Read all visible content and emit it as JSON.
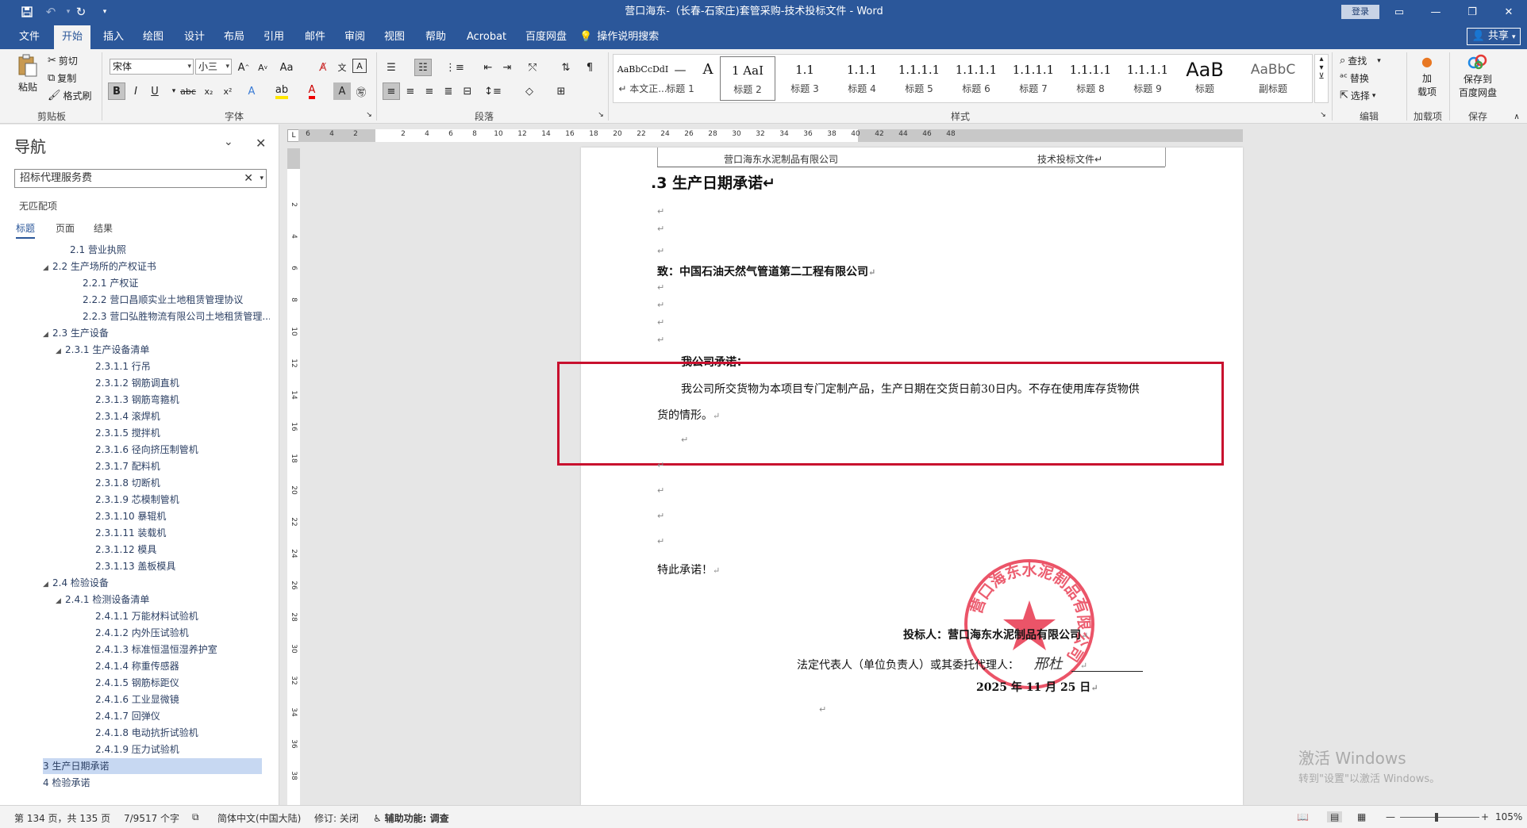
{
  "window": {
    "title": "营口海东-（长春-石家庄)套管采购-技术投标文件  -  Word",
    "login_label": "登录"
  },
  "quick_access": {
    "save_icon": "save-icon",
    "undo_icon": "undo-icon",
    "redo_icon": "redo-icon"
  },
  "menu": {
    "tabs": [
      "文件",
      "开始",
      "插入",
      "绘图",
      "设计",
      "布局",
      "引用",
      "邮件",
      "审阅",
      "视图",
      "帮助",
      "Acrobat",
      "百度网盘"
    ],
    "active_tab": "开始",
    "tell_me": "操作说明搜索",
    "share": "共享"
  },
  "ribbon": {
    "clipboard": {
      "paste": "粘贴",
      "cut": "剪切",
      "copy": "复制",
      "format_painter": "格式刷",
      "group": "剪贴板"
    },
    "font": {
      "font_name": "宋体",
      "font_size": "小三",
      "group": "字体"
    },
    "paragraph": {
      "group": "段落"
    },
    "styles": {
      "group": "样式",
      "items": [
        {
          "preview": "AaBbCcDdI",
          "name": "↵ 本文正..."
        },
        {
          "preview": "—",
          "name": "标题 1"
        },
        {
          "preview": "A",
          "name": ""
        },
        {
          "preview": "1  AaI",
          "name": "标题 2"
        },
        {
          "preview": "1.1",
          "name": "标题 3"
        },
        {
          "preview": "1.1.1",
          "name": "标题 4"
        },
        {
          "preview": "1.1.1.1",
          "name": "标题 5"
        },
        {
          "preview": "1.1.1.1",
          "name": "标题 6"
        },
        {
          "preview": "1.1.1.1",
          "name": "标题 7"
        },
        {
          "preview": "1.1.1.1",
          "name": "标题 8"
        },
        {
          "preview": "1.1.1.1",
          "name": "标题 9"
        },
        {
          "preview": "AaB",
          "name": "标题"
        },
        {
          "preview": "AaBbC",
          "name": "副标题"
        }
      ]
    },
    "editing": {
      "find": "查找",
      "replace": "替换",
      "select": "选择",
      "group": "编辑"
    },
    "addins": {
      "label": "加\n载项",
      "group": "加载项"
    },
    "save": {
      "label": "保存到\n百度网盘",
      "group": "保存"
    }
  },
  "nav": {
    "title": "导航",
    "search_value": "招标代理服务费",
    "no_match": "无匹配项",
    "tabs": [
      "标题",
      "页面",
      "结果"
    ],
    "items": [
      {
        "text": "2.1 营业执照",
        "level": 2,
        "toggle": ""
      },
      {
        "text": "2.2 生产场所的产权证书",
        "level": 1,
        "toggle": "◢"
      },
      {
        "text": "2.2.1 产权证",
        "level": 3,
        "toggle": ""
      },
      {
        "text": "2.2.2 营口昌顺实业土地租赁管理协议",
        "level": 3,
        "toggle": ""
      },
      {
        "text": "2.2.3 营口弘胜物流有限公司土地租赁管理...",
        "level": 3,
        "toggle": ""
      },
      {
        "text": "2.3 生产设备",
        "level": 1,
        "toggle": "◢"
      },
      {
        "text": "2.3.1 生产设备清单",
        "level": 2,
        "toggle": "◢"
      },
      {
        "text": "2.3.1.1 行吊",
        "level": 4,
        "toggle": ""
      },
      {
        "text": "2.3.1.2 钢筋调直机",
        "level": 4,
        "toggle": ""
      },
      {
        "text": "2.3.1.3 钢筋弯箍机",
        "level": 4,
        "toggle": ""
      },
      {
        "text": "2.3.1.4 滚焊机",
        "level": 4,
        "toggle": ""
      },
      {
        "text": "2.3.1.5 搅拌机",
        "level": 4,
        "toggle": ""
      },
      {
        "text": "2.3.1.6 径向挤压制管机",
        "level": 4,
        "toggle": ""
      },
      {
        "text": "2.3.1.7 配料机",
        "level": 4,
        "toggle": ""
      },
      {
        "text": "2.3.1.8 切断机",
        "level": 4,
        "toggle": ""
      },
      {
        "text": "2.3.1.9 芯模制管机",
        "level": 4,
        "toggle": ""
      },
      {
        "text": "2.3.1.10 暴辊机",
        "level": 4,
        "toggle": ""
      },
      {
        "text": "2.3.1.11 装载机",
        "level": 4,
        "toggle": ""
      },
      {
        "text": "2.3.1.12 模具",
        "level": 4,
        "toggle": ""
      },
      {
        "text": "2.3.1.13 盖板模具",
        "level": 4,
        "toggle": ""
      },
      {
        "text": "2.4 检验设备",
        "level": 1,
        "toggle": "◢"
      },
      {
        "text": "2.4.1 检测设备清单",
        "level": 2,
        "toggle": "◢"
      },
      {
        "text": "2.4.1.1 万能材料试验机",
        "level": 4,
        "toggle": ""
      },
      {
        "text": "2.4.1.2 内外压试验机",
        "level": 4,
        "toggle": ""
      },
      {
        "text": "2.4.1.3 标准恒温恒湿养护室",
        "level": 4,
        "toggle": ""
      },
      {
        "text": "2.4.1.4 称重传感器",
        "level": 4,
        "toggle": ""
      },
      {
        "text": "2.4.1.5 钢筋标距仪",
        "level": 4,
        "toggle": ""
      },
      {
        "text": "2.4.1.6 工业显微镜",
        "level": 4,
        "toggle": ""
      },
      {
        "text": "2.4.1.7 回弹仪",
        "level": 4,
        "toggle": ""
      },
      {
        "text": "2.4.1.8 电动抗折试验机",
        "level": 4,
        "toggle": ""
      },
      {
        "text": "2.4.1.9 压力试验机",
        "level": 4,
        "toggle": ""
      },
      {
        "text": "3 生产日期承诺",
        "level": 0,
        "toggle": "",
        "selected": true
      },
      {
        "text": "4 检验承诺",
        "level": 0,
        "toggle": ""
      }
    ]
  },
  "ruler": {
    "h_ticks": [
      "6",
      "4",
      "2",
      "",
      "2",
      "4",
      "6",
      "8",
      "10",
      "12",
      "14",
      "16",
      "18",
      "20",
      "22",
      "24",
      "26",
      "28",
      "30",
      "32",
      "34",
      "36",
      "38",
      "40",
      "42",
      "44",
      "46",
      "48"
    ],
    "v_ticks": [
      "2",
      "4",
      "6",
      "8",
      "10",
      "12",
      "14",
      "16",
      "18",
      "20",
      "22",
      "24",
      "26",
      "28",
      "30",
      "32",
      "34",
      "36",
      "38"
    ]
  },
  "document": {
    "header_left": "营口海东水泥制品有限公司",
    "header_right": "技术投标文件↵",
    "heading": ".3 生产日期承诺↵",
    "to_line": "致：中国石油天然气管道第二工程有限公司",
    "promise_title": "我公司承诺：",
    "promise_line1": "我公司所交货物为本项目专门定制产品，生产日期在交货日前30日内。不存在使用库存货物供",
    "promise_line2": "货的情形。",
    "closing": "特此承诺！",
    "bidder": "投标人：营口海东水泥制品有限公司",
    "legal_rep": "法定代表人（单位负责人）或其委托代理人：",
    "signature": "邢杜",
    "date": "2025 年 11 月 25 日",
    "pilcrow": "↵",
    "stamp_text": "营口海东水泥制品有限公司"
  },
  "status": {
    "page": "第 134 页，共 135 页",
    "words": "7/9517 个字",
    "language": "简体中文(中国大陆)",
    "track": "修订: 关闭",
    "accessibility": "辅助功能: 调查",
    "zoom": "105%"
  },
  "watermark": {
    "line1": "激活 Windows",
    "line2": "转到\"设置\"以激活 Windows。"
  },
  "colors": {
    "word_blue": "#2b579a",
    "highlight_red": "#c8102e",
    "stamp_red": "#e8364d"
  }
}
